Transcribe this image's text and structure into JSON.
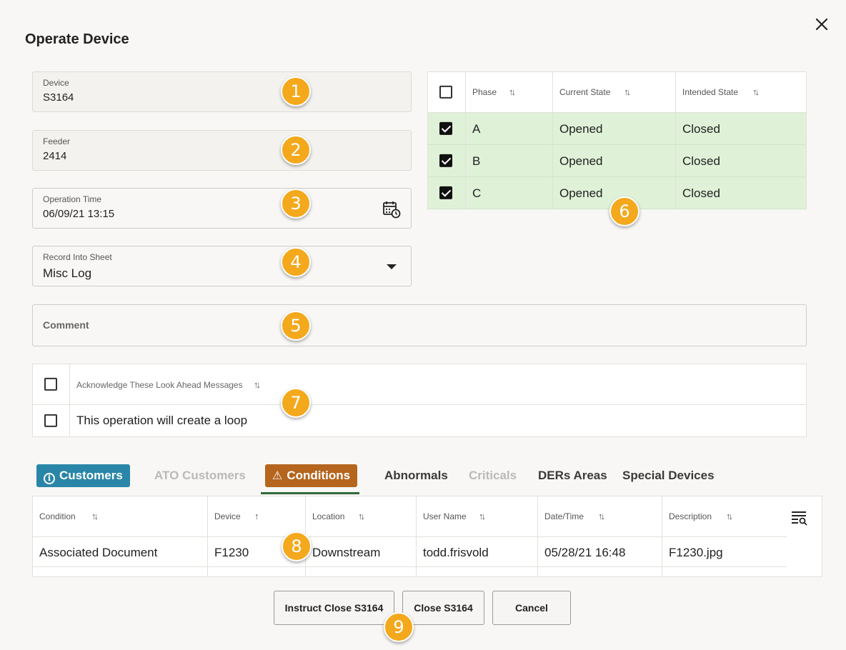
{
  "dialog": {
    "title": "Operate Device"
  },
  "fields": {
    "device": {
      "label": "Device",
      "value": "S3164"
    },
    "feeder": {
      "label": "Feeder",
      "value": "2414"
    },
    "operation_time": {
      "label": "Operation Time",
      "value": "06/09/21 13:15"
    },
    "record_sheet": {
      "label": "Record Into Sheet",
      "value": "Misc Log"
    },
    "comment": {
      "label": "Comment"
    }
  },
  "phase_table": {
    "headers": [
      "Phase",
      "Current State",
      "Intended State"
    ],
    "rows": [
      {
        "phase": "A",
        "current": "Opened",
        "intended": "Closed",
        "checked": true
      },
      {
        "phase": "B",
        "current": "Opened",
        "intended": "Closed",
        "checked": true
      },
      {
        "phase": "C",
        "current": "Opened",
        "intended": "Closed",
        "checked": true
      }
    ]
  },
  "look_ahead": {
    "header": "Acknowledge These Look Ahead Messages",
    "rows": [
      {
        "message": "This operation will create a loop",
        "checked": false
      }
    ]
  },
  "tabs": [
    "Customers",
    "ATO Customers",
    "Conditions",
    "Abnormals",
    "Criticals",
    "DERs Areas",
    "Special Devices"
  ],
  "conditions_table": {
    "headers": [
      "Condition",
      "Device",
      "Location",
      "User Name",
      "Date/Time",
      "Description"
    ],
    "rows": [
      {
        "condition": "Associated Document",
        "device": "F1230",
        "location": "Downstream",
        "user": "todd.frisvold",
        "datetime": "05/28/21 16:48",
        "description": "F1230.jpg"
      }
    ]
  },
  "buttons": {
    "instruct_close": "Instruct Close S3164",
    "close": "Close S3164",
    "cancel": "Cancel"
  },
  "callouts": [
    "1",
    "2",
    "3",
    "4",
    "5",
    "6",
    "7",
    "8",
    "9"
  ],
  "colors": {
    "callout": "#f4a81c",
    "customers_tab": "#2a86a8",
    "conditions_tab": "#b5651d",
    "phase_row": "#dff2d8"
  }
}
